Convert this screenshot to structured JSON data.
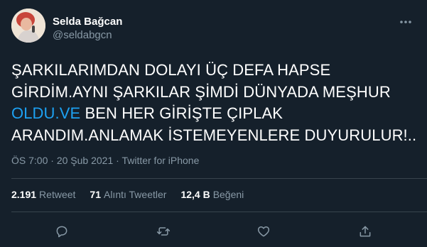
{
  "author": {
    "display_name": "Selda Bağcan",
    "handle": "@seldabgcn"
  },
  "tweet": {
    "text_before": "ŞARKILARIMDAN DOLAYI ÜÇ DEFA HAPSE GİRDİM.AYNI ŞARKILAR ŞİMDİ  DÜNYADA MEŞHUR ",
    "link_text": "OLDU.VE",
    "text_after": " BEN HER GİRİŞTE ÇIPLAK ARANDIM.ANLAMAK İSTEMEYENLERE DUYURULUR!.."
  },
  "meta": {
    "time": "ÖS 7:00",
    "separator": "·",
    "date": "20 Şub 2021",
    "source": "Twitter for iPhone"
  },
  "stats": {
    "retweets": {
      "count": "2.191",
      "label": "Retweet"
    },
    "quotes": {
      "count": "71",
      "label": "Alıntı Tweetler"
    },
    "likes": {
      "count": "12,4 B",
      "label": "Beğeni"
    }
  },
  "icons": {
    "more": "more-horizontal-icon",
    "reply": "reply-icon",
    "retweet": "retweet-icon",
    "like": "heart-icon",
    "share": "share-icon"
  },
  "colors": {
    "background": "#15202b",
    "text": "#ffffff",
    "secondary": "#8899a6",
    "link": "#1da1f2",
    "divider": "#38444d"
  }
}
